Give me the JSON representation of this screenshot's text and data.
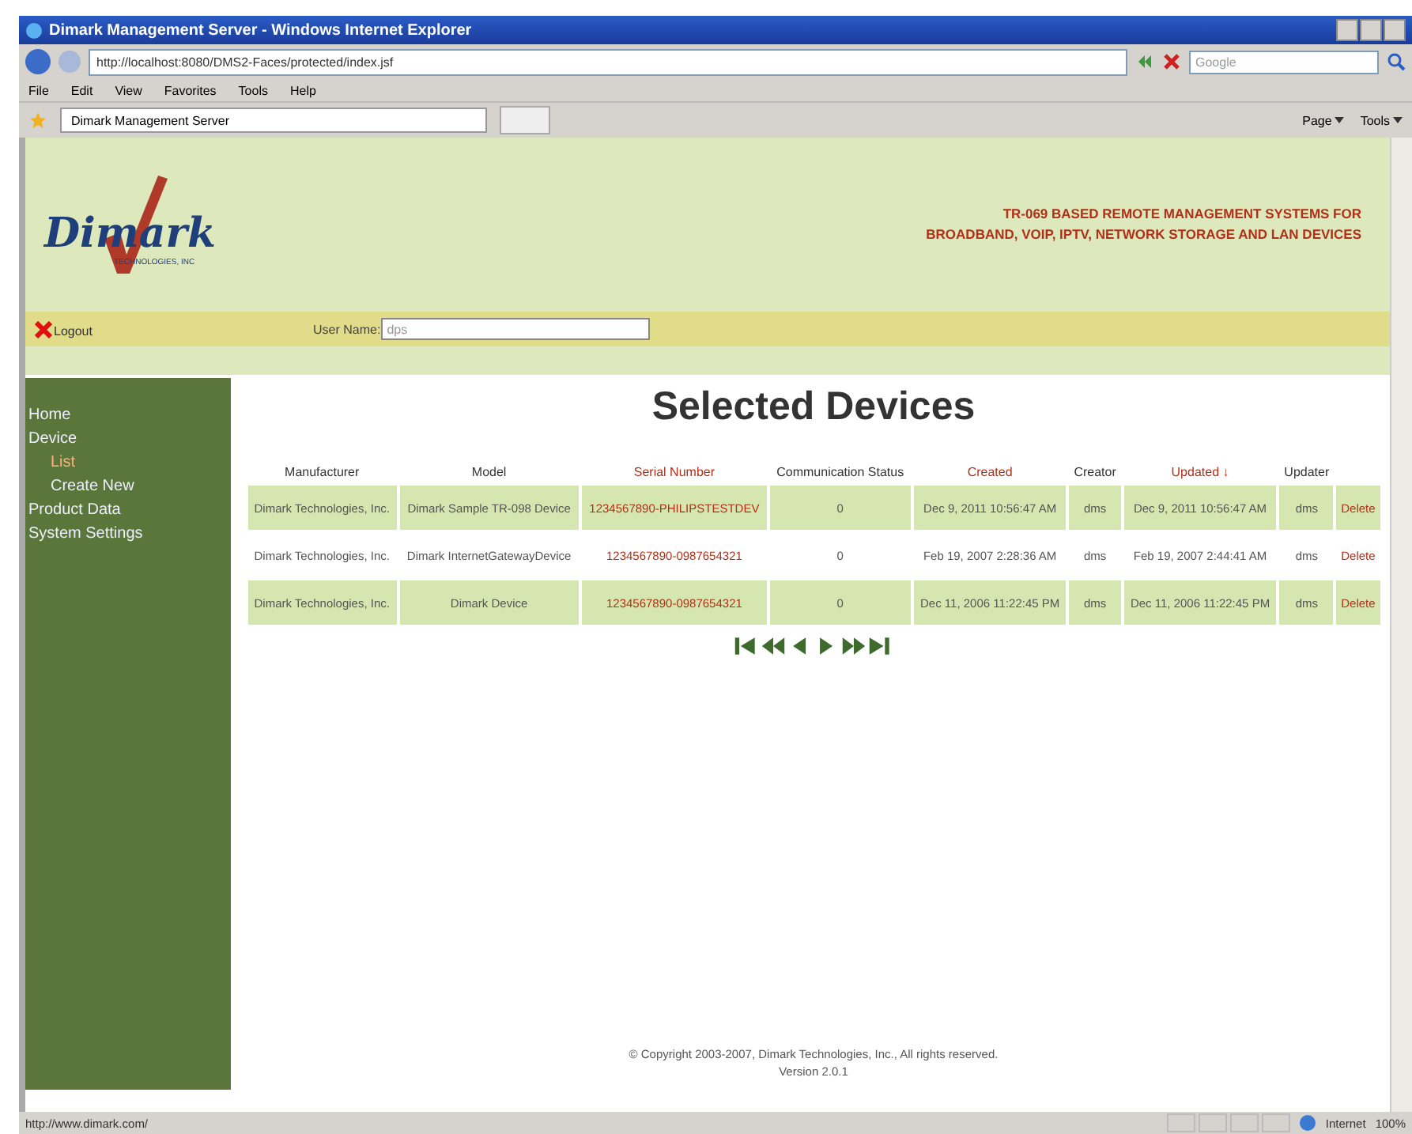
{
  "window": {
    "title": "Dimark Management Server - Windows Internet Explorer"
  },
  "address_bar": {
    "url": "http://localhost:8080/DMS2-Faces/protected/index.jsf"
  },
  "search": {
    "placeholder": "Google"
  },
  "menu": [
    "File",
    "Edit",
    "View",
    "Favorites",
    "Tools",
    "Help"
  ],
  "tab": {
    "label": "Dimark Management Server"
  },
  "command_bar": [
    "Page",
    "Tools"
  ],
  "header": {
    "logo": "Dimark",
    "logo_tagline": "TECHNOLOGIES, INC",
    "tagline_lines": [
      "TR-069 BASED REMOTE MANAGEMENT SYSTEMS FOR",
      "BROADBAND, VOIP, IPTV, NETWORK STORAGE AND LAN DEVICES"
    ]
  },
  "user_bar": {
    "logout": "Logout",
    "user_name_label": "User Name:",
    "user_name": "dps"
  },
  "sidebar": {
    "items": [
      {
        "label": "Home",
        "selected": false
      },
      {
        "label": "Device",
        "selected": false,
        "children": [
          {
            "label": "List",
            "selected": true
          },
          {
            "label": "Create New",
            "selected": false
          }
        ]
      },
      {
        "label": "Product Data",
        "selected": false
      },
      {
        "label": "System Settings",
        "selected": false
      }
    ]
  },
  "page_title": "Selected Devices",
  "table": {
    "columns": [
      {
        "label": "Manufacturer",
        "sortable": false
      },
      {
        "label": "Model",
        "sortable": false
      },
      {
        "label": "Serial Number",
        "sortable": true
      },
      {
        "label": "Communication Status",
        "sortable": false
      },
      {
        "label": "Created",
        "sortable": true
      },
      {
        "label": "Creator",
        "sortable": false
      },
      {
        "label": "Updated",
        "sortable": true,
        "sort_indicator": "↓"
      },
      {
        "label": "Updater",
        "sortable": false
      }
    ],
    "rows": [
      {
        "cells": [
          "Dimark Technologies, Inc.",
          "Dimark Sample TR-098 Device",
          "1234567890-PHILIPSTESTDEV",
          "0",
          "Dec 9, 2011 10:56:47 AM",
          "dms",
          "Dec 9, 2011 10:56:47 AM",
          "dms"
        ],
        "action": "Delete"
      },
      {
        "cells": [
          "Dimark Technologies, Inc.",
          "Dimark InternetGatewayDevice",
          "1234567890-0987654321",
          "0",
          "Feb 19, 2007 2:28:36 AM",
          "dms",
          "Feb 19, 2007 2:44:41 AM",
          "dms"
        ],
        "action": "Delete"
      },
      {
        "cells": [
          "Dimark Technologies, Inc.",
          "Dimark Device",
          "1234567890-0987654321",
          "0",
          "Dec 11, 2006 11:22:45 PM",
          "dms",
          "Dec 11, 2006 11:22:45 PM",
          "dms"
        ],
        "action": "Delete"
      }
    ]
  },
  "footer": {
    "copyright": "© Copyright 2003-2007, Dimark Technologies, Inc., All rights reserved.",
    "version": "Version 2.0.1"
  },
  "status_bar": {
    "url": "http://www.dimark.com/",
    "zone": "Internet",
    "zoom": "100%"
  }
}
